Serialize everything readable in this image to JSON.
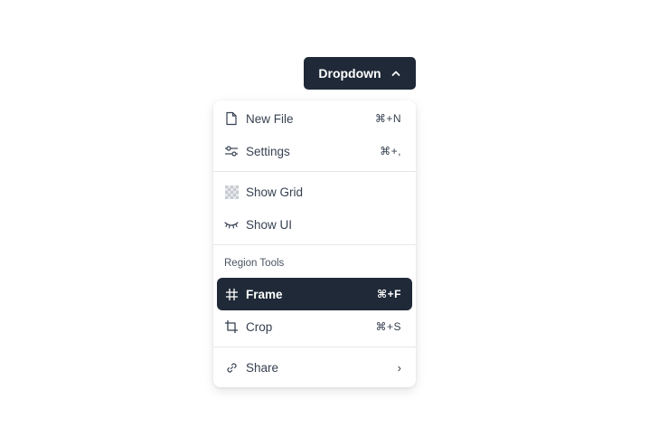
{
  "trigger": {
    "label": "Dropdown",
    "icon": "chevron-up-icon",
    "background": "#1f2937"
  },
  "menu": {
    "items": [
      {
        "label": "New File",
        "icon": "file-icon",
        "shortcut": "⌘+N"
      },
      {
        "label": "Settings",
        "icon": "sliders-icon",
        "shortcut": "⌘+,"
      },
      {
        "label": "Show Grid",
        "icon": "checkerboard-icon",
        "shortcut": ""
      },
      {
        "label": "Show UI",
        "icon": "closed-eye-icon",
        "shortcut": ""
      },
      {
        "label": "Frame",
        "icon": "hash-icon",
        "shortcut": "⌘+F",
        "active": true
      },
      {
        "label": "Crop",
        "icon": "crop-icon",
        "shortcut": "⌘+S"
      },
      {
        "label": "Share",
        "icon": "link-icon",
        "submenu_indicator": "›"
      }
    ],
    "group_label": "Region Tools"
  },
  "colors": {
    "active_bg": "#1f2937",
    "text": "#374151",
    "divider": "#e5e7eb"
  }
}
